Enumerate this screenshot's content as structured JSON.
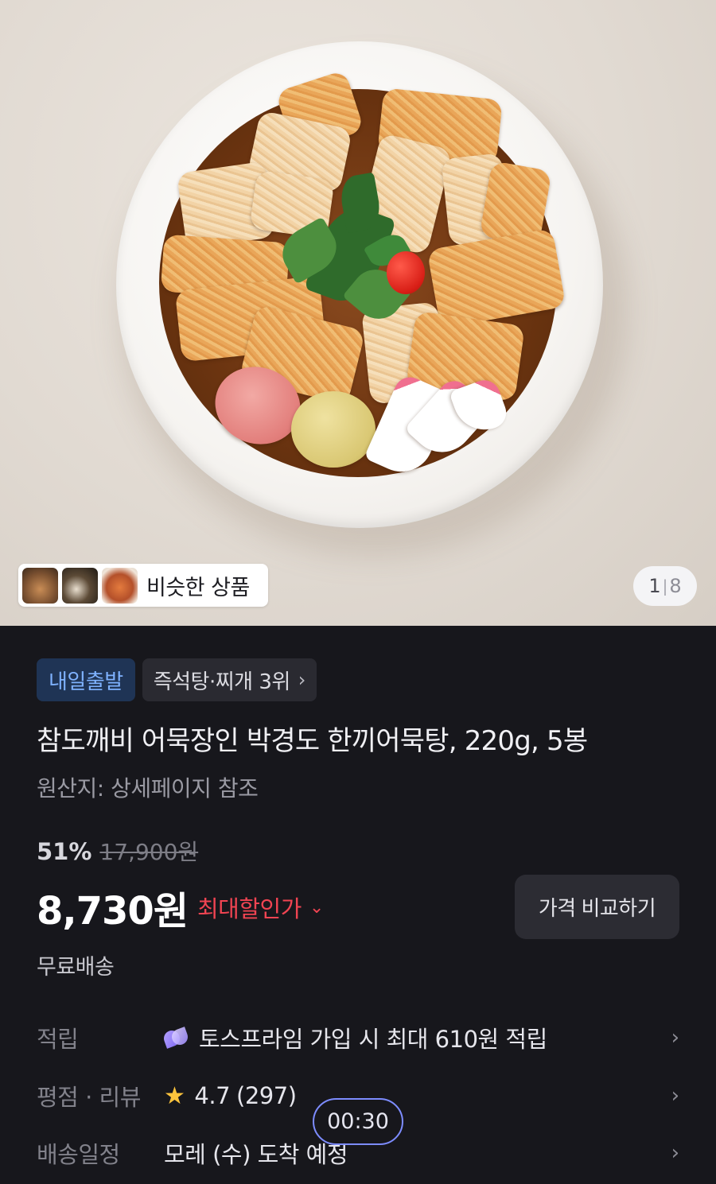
{
  "gallery": {
    "similar_label": "비슷한 상품",
    "current_index": "1",
    "separator": "|",
    "total": "8"
  },
  "badges": {
    "delivery": "내일출발",
    "category_rank": "즉석탕·찌개 3위",
    "rank_chevron": "›"
  },
  "product": {
    "title": "참도깨비 어묵장인 박경도 한끼어묵탕, 220g, 5봉",
    "origin": "원산지: 상세페이지 참조",
    "discount_rate": "51%",
    "original_price": "17,900원",
    "price": "8,730원",
    "max_discount_label": "최대할인가",
    "max_discount_chevron": "⌄",
    "compare_button": "가격 비교하기",
    "shipping": "무료배송"
  },
  "info_rows": [
    {
      "label": "적립",
      "value": "토스프라임 가입 시 최대 610원 적립",
      "icon": "prime-icon"
    },
    {
      "label": "평점 · 리뷰",
      "rating": "4.7",
      "review_count": "(297)",
      "icon": "star-icon"
    },
    {
      "label": "배송일정",
      "value": "모레 (수) 도착 예정"
    }
  ],
  "timer": "00:30",
  "colors": {
    "background": "#17171c",
    "accent_red": "#f04452",
    "badge_blue_text": "#7fb2ff",
    "star": "#ffc53d"
  }
}
